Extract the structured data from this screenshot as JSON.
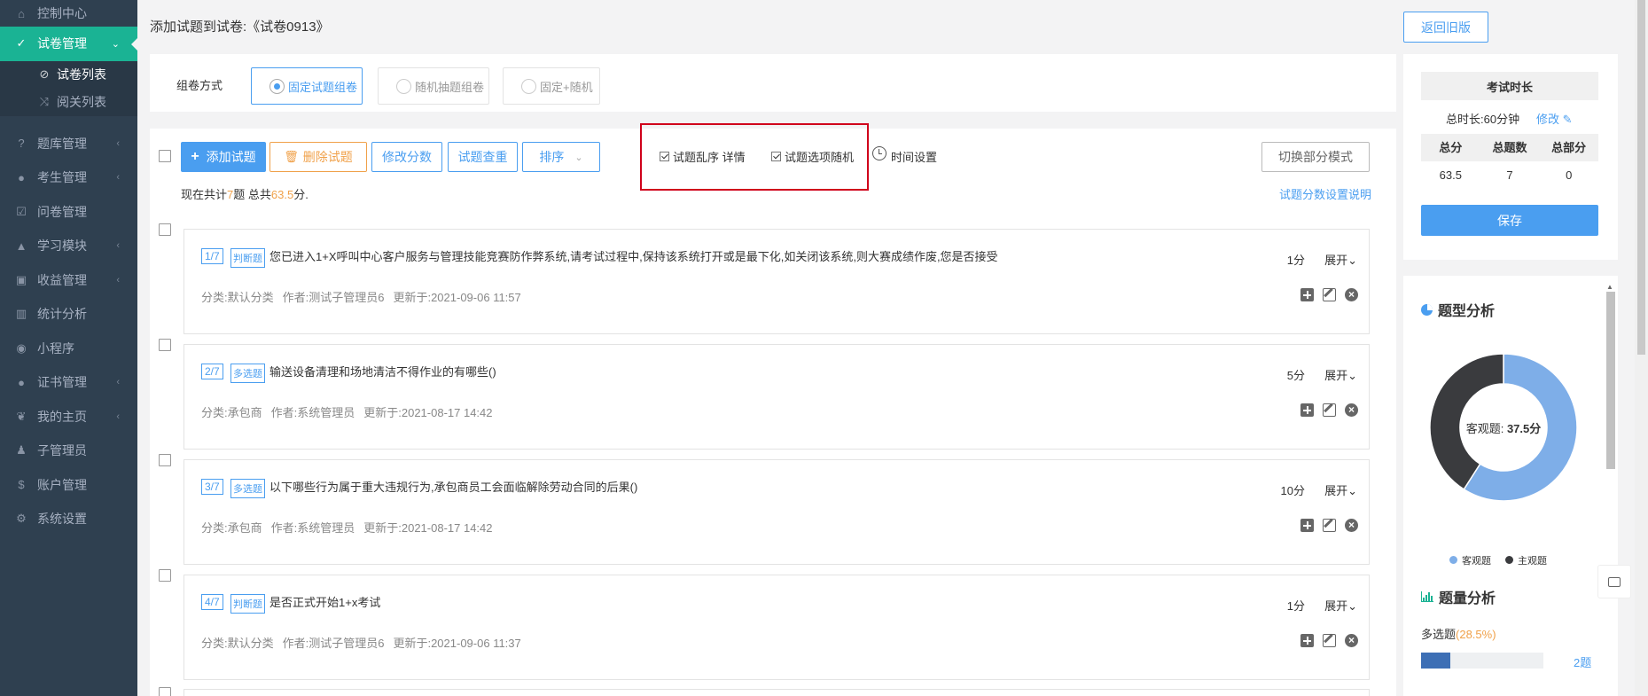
{
  "sidebar": {
    "items": [
      {
        "label": "控制中心",
        "icon": "home-icon",
        "glyph": "⌂"
      },
      {
        "label": "试卷管理",
        "icon": "check-circle-icon",
        "glyph": "✓",
        "active": true
      },
      {
        "label": "题库管理",
        "icon": "question-icon",
        "glyph": "?"
      },
      {
        "label": "考生管理",
        "icon": "user-icon",
        "glyph": "●"
      },
      {
        "label": "问卷管理",
        "icon": "checkbox-icon",
        "glyph": "☑"
      },
      {
        "label": "学习模块",
        "icon": "graduation-icon",
        "glyph": "▲"
      },
      {
        "label": "收益管理",
        "icon": "money-icon",
        "glyph": "▣"
      },
      {
        "label": "统计分析",
        "icon": "bar-chart-icon",
        "glyph": "▥"
      },
      {
        "label": "小程序",
        "icon": "wechat-icon",
        "glyph": "◉"
      },
      {
        "label": "证书管理",
        "icon": "certificate-icon",
        "glyph": "●"
      },
      {
        "label": "我的主页",
        "icon": "leaf-icon",
        "glyph": "❦"
      },
      {
        "label": "子管理员",
        "icon": "sub-admin-icon",
        "glyph": "♟"
      },
      {
        "label": "账户管理",
        "icon": "dollar-icon",
        "glyph": "$"
      },
      {
        "label": "系统设置",
        "icon": "gear-icon",
        "glyph": "⚙"
      }
    ],
    "sub_items": [
      {
        "label": "试卷列表",
        "icon": "check-circle-icon",
        "glyph": "⊘"
      },
      {
        "label": "阅关列表",
        "icon": "shuffle-icon",
        "glyph": "⤨"
      }
    ]
  },
  "header": {
    "title": "添加试题到试卷:《试卷0913》",
    "back_label": "返回旧版"
  },
  "mode": {
    "label": "组卷方式",
    "options": [
      "固定试题组卷",
      "随机抽题组卷",
      "固定+随机"
    ]
  },
  "toolbar": {
    "add_label": "添加试题",
    "delete_label": "删除试题",
    "modify_score_label": "修改分数",
    "dedupe_label": "试题查重",
    "sort_label": "排序",
    "shuffle_label": "试题乱序 详情",
    "option_random_label": "试题选项随机",
    "time_label": "时间设置",
    "switch_label": "切换部分模式",
    "score_help_link": "试题分数设置说明"
  },
  "summary": {
    "prefix": "现在共计",
    "count": "7",
    "mid": "题 总共",
    "total": "63.5",
    "suffix": "分."
  },
  "questions": [
    {
      "num": "1/7",
      "type": "判断题",
      "text": "您已进入1+X呼叫中心客户服务与管理技能竞赛防作弊系统,请考试过程中,保持该系统打开或是最下化,如关闭该系统,则大赛成绩作废,您是否接受",
      "score": "1分",
      "expand": "展开⌄",
      "category": "分类:默认分类",
      "author": "作者:测试子管理员6",
      "updated": "更新于:2021-09-06 11:57"
    },
    {
      "num": "2/7",
      "type": "多选题",
      "text": "输送设备清理和场地清洁不得作业的有哪些()",
      "score": "5分",
      "expand": "展开⌄",
      "category": "分类:承包商",
      "author": "作者:系统管理员",
      "updated": "更新于:2021-08-17 14:42"
    },
    {
      "num": "3/7",
      "type": "多选题",
      "text": "以下哪些行为属于重大违规行为,承包商员工会面临解除劳动合同的后果()",
      "score": "10分",
      "expand": "展开⌄",
      "category": "分类:承包商",
      "author": "作者:系统管理员",
      "updated": "更新于:2021-08-17 14:42"
    },
    {
      "num": "4/7",
      "type": "判断题",
      "text": "是否正式开始1+x考试",
      "score": "1分",
      "expand": "展开⌄",
      "category": "分类:默认分类",
      "author": "作者:测试子管理员6",
      "updated": "更新于:2021-09-06 11:37"
    }
  ],
  "exam": {
    "head": "考试时长",
    "duration": "总时长:60分钟",
    "edit_label": "修改",
    "cols": [
      "总分",
      "总题数",
      "总部分"
    ],
    "vals": [
      "63.5",
      "7",
      "0"
    ],
    "save_label": "保存"
  },
  "analysis": {
    "type_title": "题型分析",
    "donut_label_prefix": "客观题: ",
    "donut_label_value": "37.5分",
    "legend": [
      {
        "name": "客观题",
        "color": "#7eaee8"
      },
      {
        "name": "主观题",
        "color": "#3a3b3e"
      }
    ],
    "count_title": "题量分析",
    "qa_label": "多选题",
    "qa_pct": "(28.5%)",
    "qa_count": "2题",
    "qa_fraction": 0.285
  },
  "chart_data": {
    "type": "pie",
    "categories": [
      "客观题",
      "主观题"
    ],
    "values": [
      37.5,
      26
    ],
    "colors": [
      "#7eaee8",
      "#3a3b3e"
    ]
  }
}
